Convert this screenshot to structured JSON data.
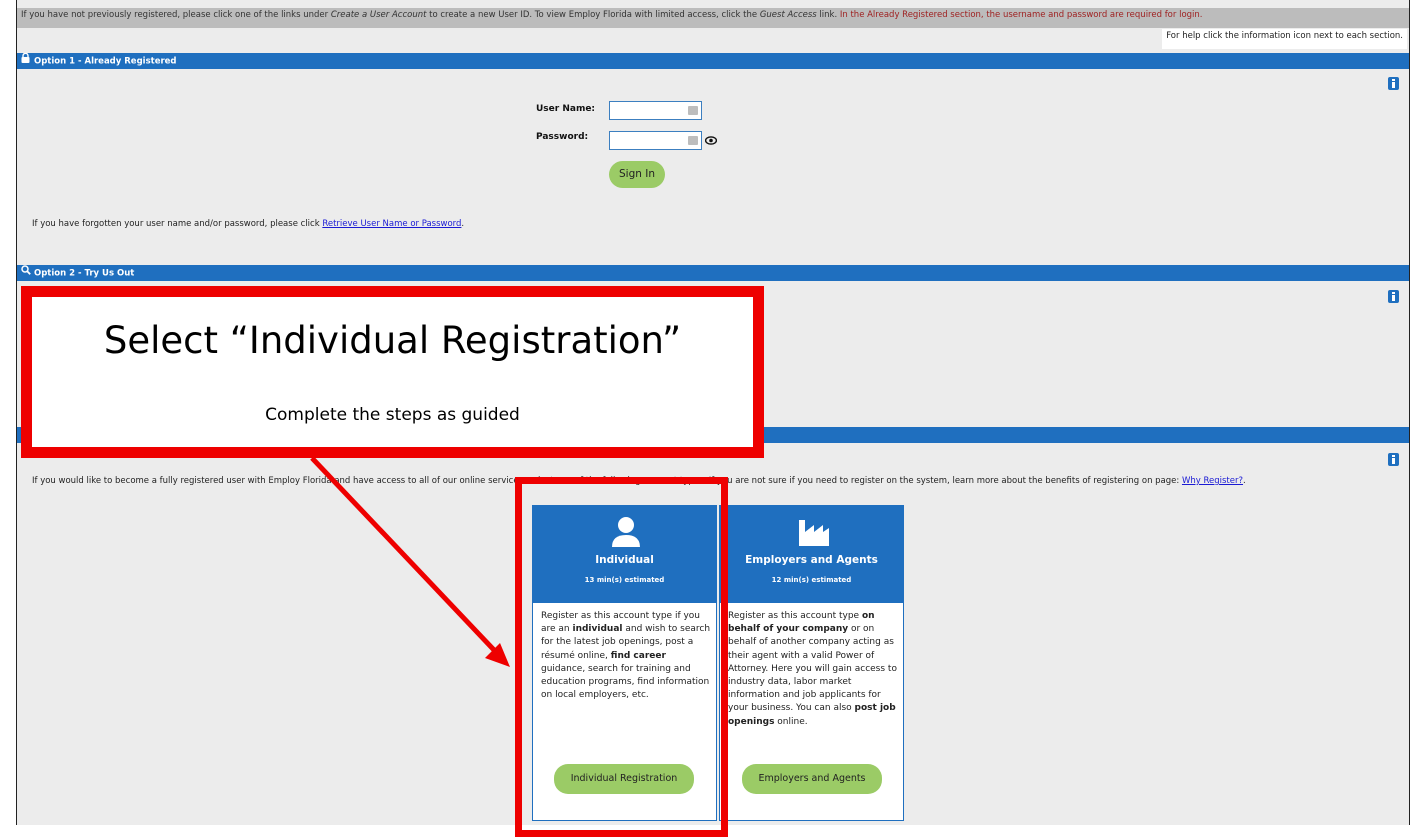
{
  "notice": {
    "part1": "If you have not previously registered, please click one of the links under ",
    "part1_em": "Create a User Account",
    "part2": " to create a new User ID. To view Employ Florida with limited access, click the ",
    "part2_em": "Guest Access",
    "part3": " link. ",
    "red": "In the Already Registered section, the username and password are required for login."
  },
  "help_text": "For help click the information icon next to each section.",
  "option1": {
    "title": "Option 1 - Already Registered",
    "username_label": "User Name:",
    "username_value": "",
    "password_label": "Password:",
    "password_value": "",
    "signin_label": "Sign In",
    "forgot_text": "If you have forgotten your user name and/or password, please click ",
    "forgot_link": "Retrieve User Name or Password",
    "forgot_end": "."
  },
  "option2": {
    "title": "Option 2 - Try Us Out"
  },
  "option3": {
    "intro": "If you would like to become a fully registered user with Employ Florida and have access to all of our online services, select one of the following account types. If you are not sure if you need to register on the system, learn more about the benefits of registering on page: ",
    "why_link": "Why Register?",
    "why_end": "."
  },
  "cards": [
    {
      "title": "Individual",
      "estimate": "13 min(s) estimated",
      "body_html": "Register as this account type if you are an <b>individual</b> and wish to search for the latest job openings, post a résumé online, <b>find career</b> guidance, search for training and education programs, find information on local employers, etc.",
      "button": "Individual Registration",
      "icon": "person-icon"
    },
    {
      "title": "Employers and Agents",
      "estimate": "12 min(s) estimated",
      "body_html": "Register as this account type <b>on behalf of your company</b> or on behalf of another company acting as their agent with a valid Power of Attorney. Here you will gain access to industry data, labor market information and job applicants for your business. You can also <b>post job openings</b> online.",
      "button": "Employers and Agents",
      "icon": "factory-icon"
    }
  ],
  "callout": {
    "title": "Select “Individual Registration”",
    "subtitle": "Complete the steps as guided"
  },
  "colors": {
    "section_bar": "#1f6fbf",
    "button_green": "#9bcb66",
    "annotation_red": "#ee0000",
    "notice_red": "#9e1e1e"
  }
}
